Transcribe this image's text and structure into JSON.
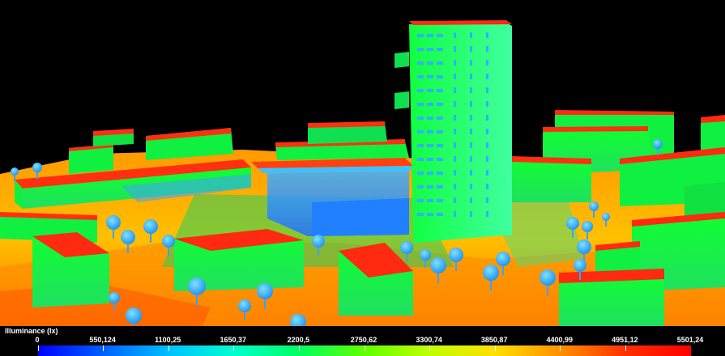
{
  "legend": {
    "title": "Illuminance (lx)",
    "ticks": [
      "0",
      "550,124",
      "1100,25",
      "1650,37",
      "2200,5",
      "2750,62",
      "3300,74",
      "3850,87",
      "4400,99",
      "4951,12",
      "5501,24"
    ],
    "colormap": [
      "#0000ff",
      "#0060ff",
      "#00c0ff",
      "#00ffd0",
      "#00ff60",
      "#60ff00",
      "#c0ff00",
      "#ffe000",
      "#ff9000",
      "#ff3000",
      "#ff0000"
    ]
  },
  "colors": {
    "background": "#000000",
    "ground_hot": "#ff7a00",
    "roof": "#ff2a10",
    "wall": "#10f040",
    "tree": "#2ab0ff"
  }
}
